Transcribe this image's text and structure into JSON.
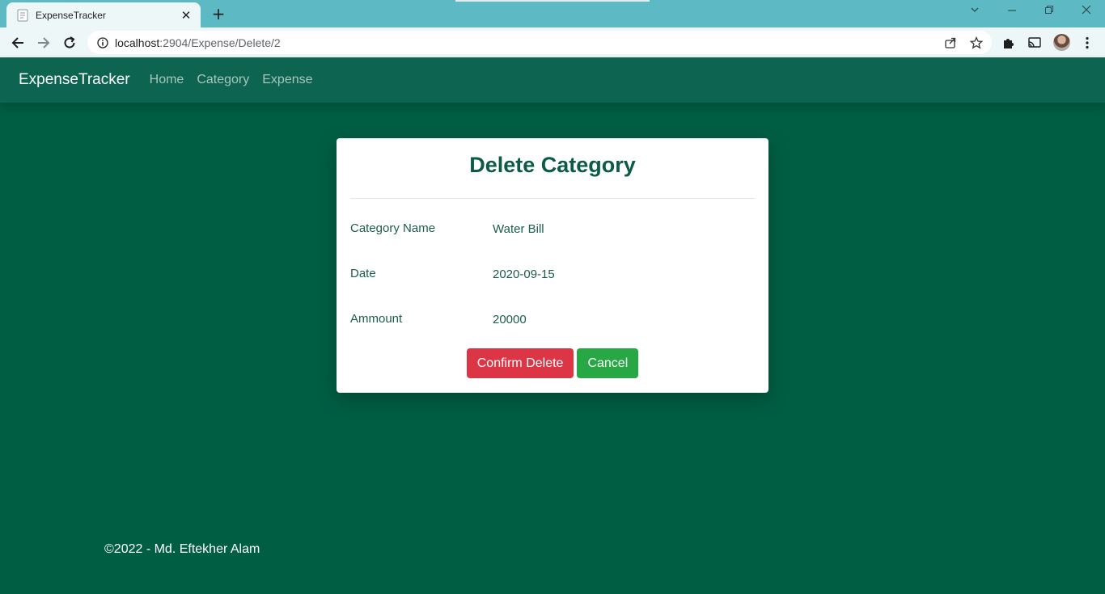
{
  "browser": {
    "tab_title": "ExpenseTracker",
    "tab_close": "✕",
    "new_tab": "+",
    "url_host": "localhost",
    "url_path": ":2904/Expense/Delete/2"
  },
  "navbar": {
    "brand": "ExpenseTracker",
    "links": [
      "Home",
      "Category",
      "Expense"
    ]
  },
  "card": {
    "title": "Delete Category",
    "fields": [
      {
        "label": "Category Name",
        "value": "Water Bill"
      },
      {
        "label": "Date",
        "value": "2020-09-15"
      },
      {
        "label": "Ammount",
        "value": "20000"
      }
    ],
    "confirm_label": "Confirm Delete",
    "cancel_label": "Cancel"
  },
  "footer": {
    "text": "©2022 - Md. Eftekher Alam"
  },
  "colors": {
    "page_bg": "#005e43",
    "navbar_bg": "#0d6551",
    "danger": "#dc3545",
    "success": "#28a745",
    "title": "#0b5b46"
  }
}
